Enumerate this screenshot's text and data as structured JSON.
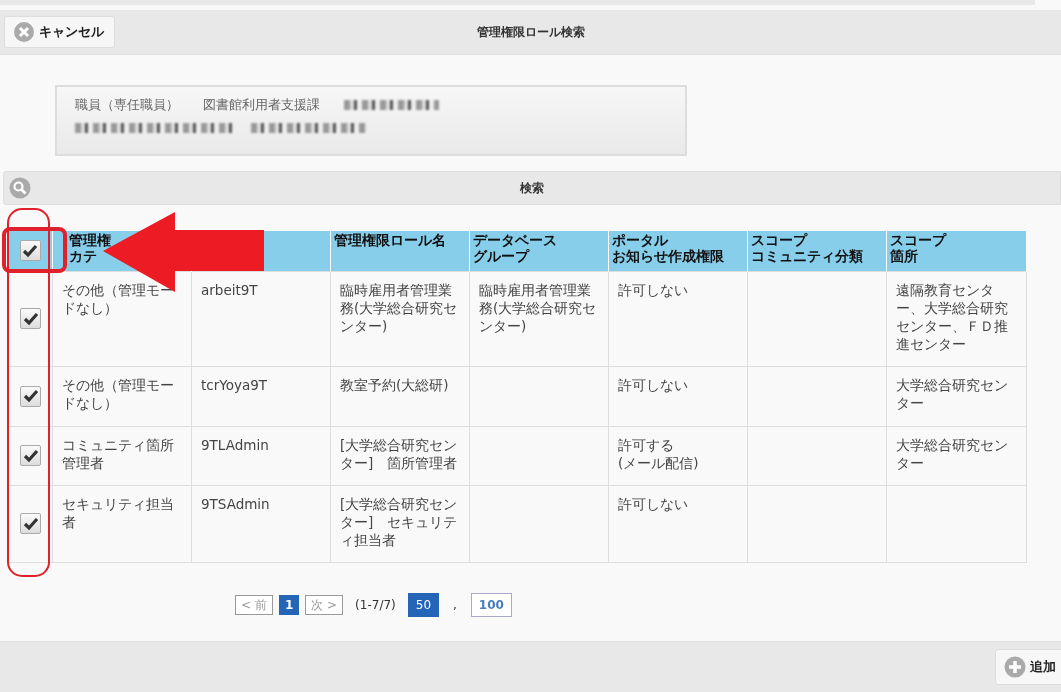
{
  "title": "管理権限ロール検索",
  "cancel_button": "キャンセル",
  "user_info": {
    "texts": [
      "職員（専任職員）",
      "図書館利用者支援課"
    ]
  },
  "search_bar": {
    "label": "検索"
  },
  "table": {
    "select_all": {
      "checked": true
    },
    "columns": [
      {
        "lines": [
          "管理権",
          "カテ"
        ]
      },
      {},
      {
        "lines": [
          "管理権限ロール名"
        ]
      },
      {
        "lines": [
          "データベース",
          "グループ"
        ]
      },
      {
        "lines": [
          "ポータル",
          "お知らせ作成権限"
        ]
      },
      {
        "lines": [
          "スコープ",
          "コミュニティ分類"
        ]
      },
      {
        "lines": [
          "スコープ",
          "箇所"
        ]
      }
    ],
    "rows": [
      {
        "checked": true,
        "cells": [
          "その他（管理モードなし）",
          "arbeit9T",
          "臨時雇用者管理業務(大学総合研究センター)",
          "臨時雇用者管理業務(大学総合研究センター)",
          "許可しない",
          null,
          "遠隔教育センター、大学総合研究センター、ＦＤ推進センター"
        ]
      },
      {
        "checked": true,
        "cells": [
          "その他（管理モードなし）",
          "tcrYoya9T",
          "教室予約(大総研)",
          null,
          "許可しない",
          null,
          "大学総合研究センター"
        ]
      },
      {
        "checked": true,
        "cells": [
          "コミュニティ箇所管理者",
          "9TLAdmin",
          "[大学総合研究センター]　箇所管理者",
          null,
          "許可する\n(メール配信)",
          null,
          "大学総合研究センター"
        ]
      },
      {
        "checked": true,
        "cells": [
          "セキュリティ担当者",
          "9TSAdmin",
          "[大学総合研究センター]　セキュリティ担当者",
          null,
          "許可しない",
          null,
          null
        ]
      }
    ]
  },
  "pagination": {
    "prev": {
      "label": "< 前",
      "disabled": true
    },
    "pages": [
      {
        "label": "1",
        "selected": true
      }
    ],
    "next": {
      "label": "次 >",
      "disabled": true
    },
    "range": "(1-7/7)",
    "page_sizes": [
      {
        "label": "50",
        "selected": true
      },
      {
        "label": "100",
        "selected": false
      }
    ],
    "separator": ","
  },
  "add_button": "追加"
}
